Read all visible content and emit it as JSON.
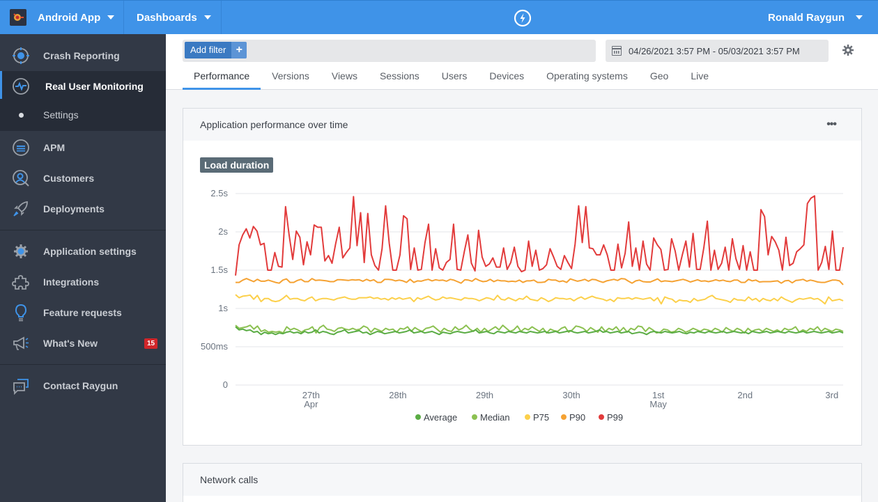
{
  "topbar": {
    "app_name": "Android App",
    "dashboards_label": "Dashboards",
    "user_name": "Ronald Raygun",
    "logo_icon": "lightning-circle-icon"
  },
  "sidebar": {
    "items": [
      {
        "label": "Crash Reporting",
        "icon": "crash-reporting-bug-icon"
      },
      {
        "label": "Real User Monitoring",
        "icon": "pulse-icon",
        "active": true
      },
      {
        "label": "Settings",
        "icon": "dot-icon",
        "sub": true
      },
      {
        "label": "APM",
        "icon": "apm-icon"
      },
      {
        "label": "Customers",
        "icon": "customer-search-icon"
      },
      {
        "label": "Deployments",
        "icon": "rocket-icon"
      },
      {
        "label": "Application settings",
        "icon": "gear-icon"
      },
      {
        "label": "Integrations",
        "icon": "puzzle-icon"
      },
      {
        "label": "Feature requests",
        "icon": "lightbulb-icon"
      },
      {
        "label": "What's New",
        "icon": "megaphone-icon",
        "badge": "15"
      },
      {
        "label": "Contact Raygun",
        "icon": "chat-icon"
      }
    ]
  },
  "filters": {
    "add_filter_label": "Add filter",
    "add_filter_plus": "+",
    "date_range": "04/26/2021 3:57 PM - 05/03/2021 3:57 PM"
  },
  "tabs": [
    {
      "label": "Performance",
      "active": true
    },
    {
      "label": "Versions"
    },
    {
      "label": "Views"
    },
    {
      "label": "Sessions"
    },
    {
      "label": "Users"
    },
    {
      "label": "Devices"
    },
    {
      "label": "Operating systems"
    },
    {
      "label": "Geo"
    },
    {
      "label": "Live"
    }
  ],
  "cards": {
    "performance_title": "Application performance over time",
    "more_label": "•••",
    "chart_tag": "Load duration",
    "network_title": "Network calls"
  },
  "colors": {
    "accent": "#3f93e8",
    "average": "#5aac44",
    "median": "#8cc152",
    "p75": "#fcd04b",
    "p90": "#f5a233",
    "p99": "#e23b3b",
    "badge": "#d0262a"
  },
  "chart_data": {
    "type": "line",
    "title": "Load duration",
    "xlabel": "",
    "ylabel": "",
    "y_unit": "ms",
    "ylim": [
      0,
      2500
    ],
    "y_ticks": [
      {
        "value": 0,
        "label": "0"
      },
      {
        "value": 500,
        "label": "500ms"
      },
      {
        "value": 1000,
        "label": "1s"
      },
      {
        "value": 1500,
        "label": "1.5s"
      },
      {
        "value": 2000,
        "label": "2s"
      },
      {
        "value": 2500,
        "label": "2.5s"
      }
    ],
    "x_range_days": [
      -0.87,
      6.13
    ],
    "x_ticks": [
      {
        "day": 0,
        "label": "27th",
        "sublabel": "Apr"
      },
      {
        "day": 1,
        "label": "28th",
        "sublabel": ""
      },
      {
        "day": 2,
        "label": "29th",
        "sublabel": ""
      },
      {
        "day": 3,
        "label": "30th",
        "sublabel": ""
      },
      {
        "day": 4,
        "label": "1st",
        "sublabel": "May"
      },
      {
        "day": 5,
        "label": "2nd",
        "sublabel": ""
      },
      {
        "day": 6,
        "label": "3rd",
        "sublabel": ""
      }
    ],
    "grid": true,
    "legend_position": "bottom",
    "sample_interval_hours": 1,
    "series": [
      {
        "name": "Average",
        "color_key": "average",
        "values": [
          760,
          720,
          730,
          710,
          720,
          690,
          700,
          660,
          690,
          670,
          680,
          660,
          680,
          670,
          690,
          700,
          680,
          690,
          670,
          700,
          680,
          690,
          720,
          680,
          700,
          690,
          670,
          660,
          690,
          700,
          720,
          680,
          690,
          700,
          710,
          680,
          690,
          660,
          680,
          700,
          690,
          670,
          680,
          690,
          700,
          680,
          690,
          700,
          720,
          680,
          690,
          700,
          680,
          690,
          700,
          680,
          660,
          690,
          680,
          670,
          690,
          700,
          690,
          680,
          690,
          700,
          720,
          680,
          690,
          700,
          680,
          670,
          700,
          690,
          680,
          700,
          690,
          680,
          700,
          690,
          680,
          700,
          690,
          680,
          690,
          700,
          680,
          690,
          700,
          680,
          690,
          700,
          710,
          690,
          680,
          690,
          700,
          680,
          690,
          700,
          720,
          690,
          700,
          680,
          690,
          700,
          680,
          690,
          700,
          670,
          680,
          690,
          680,
          660,
          690,
          700,
          690,
          680,
          700,
          690,
          680,
          690,
          700,
          680,
          670,
          690,
          680,
          700,
          690,
          680,
          700,
          690,
          680,
          690,
          700,
          680,
          690,
          700,
          690,
          680,
          690,
          670,
          700,
          690,
          680,
          690,
          700,
          680,
          690,
          700,
          690,
          680,
          700,
          690,
          680,
          690,
          700,
          680,
          690,
          700,
          690,
          680,
          690,
          700,
          680,
          690,
          700,
          680
        ]
      },
      {
        "name": "Median",
        "color_key": "median",
        "values": [
          780,
          740,
          750,
          760,
          780,
          730,
          770,
          700,
          720,
          690,
          700,
          690,
          700,
          680,
          760,
          720,
          740,
          720,
          690,
          720,
          730,
          760,
          680,
          750,
          780,
          730,
          720,
          700,
          740,
          750,
          730,
          720,
          740,
          720,
          730,
          770,
          750,
          690,
          740,
          720,
          700,
          740,
          720,
          730,
          690,
          740,
          730,
          760,
          700,
          750,
          720,
          700,
          740,
          750,
          770,
          730,
          690,
          740,
          710,
          700,
          760,
          720,
          740,
          780,
          730,
          700,
          740,
          690,
          740,
          700,
          730,
          760,
          720,
          780,
          740,
          700,
          720,
          770,
          700,
          740,
          720,
          760,
          730,
          700,
          740,
          680,
          730,
          710,
          700,
          740,
          760,
          690,
          720,
          770,
          760,
          740,
          700,
          750,
          720,
          690,
          760,
          700,
          740,
          720,
          760,
          700,
          750,
          690,
          740,
          720,
          770,
          760,
          700,
          750,
          720,
          680,
          690,
          730,
          720,
          690,
          700,
          740,
          720,
          690,
          710,
          740,
          720,
          700,
          730,
          720,
          700,
          740,
          720,
          690,
          750,
          720,
          700,
          740,
          720,
          680,
          740,
          700,
          720,
          730,
          700,
          740,
          720,
          700,
          720,
          690,
          740,
          720,
          730,
          760,
          690,
          720,
          700,
          740,
          720,
          760,
          700,
          740,
          720,
          700,
          730,
          720,
          700
        ]
      },
      {
        "name": "P75",
        "color_key": "p75",
        "values": [
          1180,
          1140,
          1160,
          1165,
          1175,
          1120,
          1170,
          1090,
          1130,
          1130,
          1100,
          1090,
          1100,
          1130,
          1170,
          1120,
          1130,
          1130,
          1110,
          1100,
          1130,
          1150,
          1100,
          1120,
          1130,
          1130,
          1120,
          1110,
          1130,
          1140,
          1150,
          1130,
          1120,
          1120,
          1140,
          1140,
          1140,
          1150,
          1130,
          1140,
          1120,
          1130,
          1110,
          1140,
          1120,
          1140,
          1120,
          1130,
          1140,
          1090,
          1140,
          1120,
          1140,
          1160,
          1130,
          1110,
          1120,
          1150,
          1130,
          1140,
          1130,
          1120,
          1110,
          1140,
          1130,
          1130,
          1120,
          1100,
          1120,
          1140,
          1130,
          1110,
          1170,
          1120,
          1110,
          1140,
          1120,
          1100,
          1130,
          1120,
          1160,
          1120,
          1110,
          1100,
          1140,
          1120,
          1090,
          1110,
          1140,
          1130,
          1130,
          1120,
          1130,
          1100,
          1130,
          1150,
          1120,
          1140,
          1160,
          1140,
          1130,
          1120,
          1100,
          1120,
          1090,
          1140,
          1130,
          1130,
          1140,
          1120,
          1140,
          1130,
          1120,
          1130,
          1140,
          1100,
          1140,
          1060,
          1150,
          1130,
          1120,
          1080,
          1110,
          1100,
          1100,
          1080,
          1130,
          1100,
          1110,
          1120,
          1150,
          1170,
          1130,
          1120,
          1110,
          1100,
          1080,
          1130,
          1110,
          1110,
          1100,
          1150,
          1110,
          1130,
          1090,
          1130,
          1110,
          1100,
          1130,
          1100,
          1150,
          1120,
          1100,
          1080,
          1110,
          1130,
          1120,
          1130,
          1140,
          1120,
          1130,
          1100,
          1060,
          1150,
          1100,
          1110,
          1120,
          1100
        ]
      },
      {
        "name": "P90",
        "color_key": "p90",
        "values": [
          1340,
          1340,
          1370,
          1390,
          1370,
          1350,
          1380,
          1355,
          1355,
          1370,
          1355,
          1340,
          1330,
          1370,
          1385,
          1340,
          1340,
          1365,
          1380,
          1350,
          1350,
          1390,
          1365,
          1370,
          1365,
          1360,
          1350,
          1350,
          1375,
          1375,
          1370,
          1365,
          1375,
          1370,
          1375,
          1355,
          1380,
          1360,
          1375,
          1340,
          1340,
          1380,
          1380,
          1375,
          1360,
          1370,
          1360,
          1340,
          1380,
          1340,
          1360,
          1355,
          1370,
          1380,
          1360,
          1375,
          1365,
          1370,
          1355,
          1380,
          1370,
          1350,
          1330,
          1375,
          1370,
          1355,
          1390,
          1365,
          1350,
          1355,
          1380,
          1350,
          1370,
          1360,
          1360,
          1350,
          1355,
          1350,
          1370,
          1340,
          1360,
          1360,
          1370,
          1340,
          1340,
          1345,
          1380,
          1370,
          1370,
          1350,
          1360,
          1340,
          1385,
          1370,
          1355,
          1365,
          1380,
          1355,
          1380,
          1375,
          1355,
          1340,
          1360,
          1370,
          1380,
          1365,
          1390,
          1385,
          1355,
          1330,
          1360,
          1370,
          1350,
          1345,
          1345,
          1365,
          1385,
          1350,
          1360,
          1355,
          1350,
          1360,
          1370,
          1380,
          1365,
          1345,
          1360,
          1375,
          1355,
          1360,
          1350,
          1360,
          1375,
          1360,
          1370,
          1355,
          1350,
          1370,
          1370,
          1340,
          1340,
          1380,
          1360,
          1370,
          1345,
          1350,
          1350,
          1350,
          1355,
          1360,
          1330,
          1360,
          1365,
          1335,
          1365,
          1370,
          1380,
          1355,
          1370,
          1360,
          1345,
          1340,
          1340,
          1355,
          1370,
          1370,
          1360,
          1310
        ]
      },
      {
        "name": "P99",
        "color_key": "p99",
        "values": [
          1430,
          1830,
          1960,
          2040,
          1920,
          2070,
          2010,
          1830,
          1850,
          1500,
          1500,
          1730,
          1550,
          1540,
          2330,
          1960,
          1640,
          2010,
          1930,
          1570,
          1870,
          1700,
          2090,
          2060,
          2060,
          1620,
          1690,
          1590,
          1840,
          2060,
          1660,
          1730,
          1790,
          2460,
          1820,
          2250,
          1600,
          2240,
          1700,
          1560,
          1500,
          1780,
          2340,
          1850,
          1500,
          1500,
          1700,
          2210,
          2170,
          1510,
          1790,
          1500,
          1510,
          1860,
          2100,
          1500,
          1780,
          1530,
          1500,
          1600,
          1640,
          2100,
          1510,
          1500,
          1740,
          1960,
          1590,
          1490,
          2020,
          1670,
          1550,
          1580,
          1660,
          1540,
          1540,
          1790,
          1510,
          1600,
          1800,
          1550,
          1480,
          1500,
          1880,
          1550,
          1760,
          1500,
          1520,
          1570,
          1780,
          1670,
          1550,
          1510,
          1690,
          1600,
          1520,
          1840,
          2340,
          1860,
          2330,
          1790,
          1780,
          1700,
          1700,
          1830,
          1700,
          1500,
          1500,
          1840,
          1530,
          1720,
          2130,
          1550,
          1790,
          1500,
          1880,
          1580,
          1500,
          1920,
          1830,
          1770,
          1500,
          1510,
          1910,
          1750,
          1500,
          1700,
          1880,
          1540,
          1980,
          1510,
          1510,
          1790,
          2140,
          1500,
          1760,
          1510,
          1590,
          1800,
          1500,
          1910,
          1650,
          1510,
          1820,
          1500,
          1740,
          1500,
          1500,
          2290,
          2200,
          1700,
          1940,
          1870,
          1760,
          1500,
          1930,
          1560,
          1590,
          1740,
          1780,
          1830,
          2370,
          2440,
          2470,
          1500,
          1600,
          1810,
          1510,
          2010,
          1500,
          1500,
          1800
        ]
      }
    ]
  }
}
